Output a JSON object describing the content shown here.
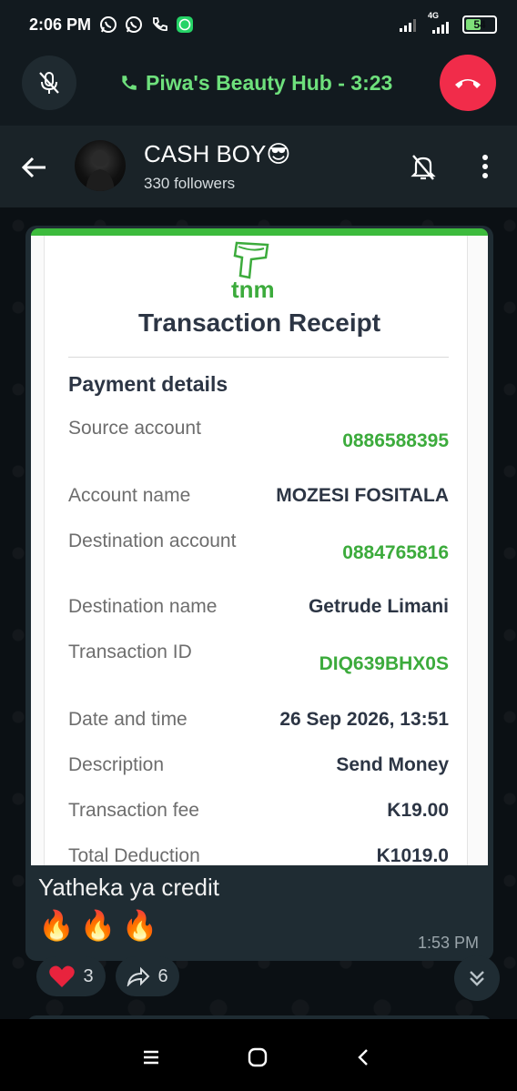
{
  "status_bar": {
    "time": "2:06 PM",
    "network_label": "4G",
    "battery_level": 54,
    "battery_text": "54",
    "app_icons": [
      "whatsapp-icon",
      "whatsapp-icon",
      "phone-icon",
      "whatsapp-business-icon"
    ]
  },
  "call_bar": {
    "label": "Piwa's Beauty Hub - 3:23",
    "accent": "#6ee07c",
    "end_call_color": "#f12c4a"
  },
  "header": {
    "channel_name": "CASH BOY😎",
    "followers": "330 followers"
  },
  "receipt": {
    "logo_text": "tnm",
    "title": "Transaction Receipt",
    "section_title": "Payment details",
    "rows": [
      {
        "label": "Source account",
        "value": "0886588395",
        "highlight": true
      },
      {
        "label": "Account name",
        "value": "MOZESI FOSITALA",
        "highlight": false
      },
      {
        "label": "Destination account",
        "value": "0884765816",
        "highlight": true
      },
      {
        "label": "Destination name",
        "value": "Getrude Limani",
        "highlight": false
      },
      {
        "label": "Transaction ID",
        "value": "DIQ639BHX0S",
        "highlight": true
      },
      {
        "label": "Date and time",
        "value": "26 Sep 2026, 13:51",
        "highlight": false
      },
      {
        "label": "Description",
        "value": "Send Money",
        "highlight": false
      },
      {
        "label": "Transaction fee",
        "value": "K19.00",
        "highlight": false
      },
      {
        "label": "Total Deduction",
        "value": "K1019.0",
        "highlight": false
      }
    ]
  },
  "message": {
    "caption": "Yatheka ya credit",
    "emojis": "🔥🔥🔥",
    "time": "1:53 PM"
  },
  "reactions": {
    "heart_count": "3",
    "forward_count": "6"
  },
  "nav": {
    "icons": [
      "recents-icon",
      "home-icon",
      "back-icon"
    ]
  }
}
